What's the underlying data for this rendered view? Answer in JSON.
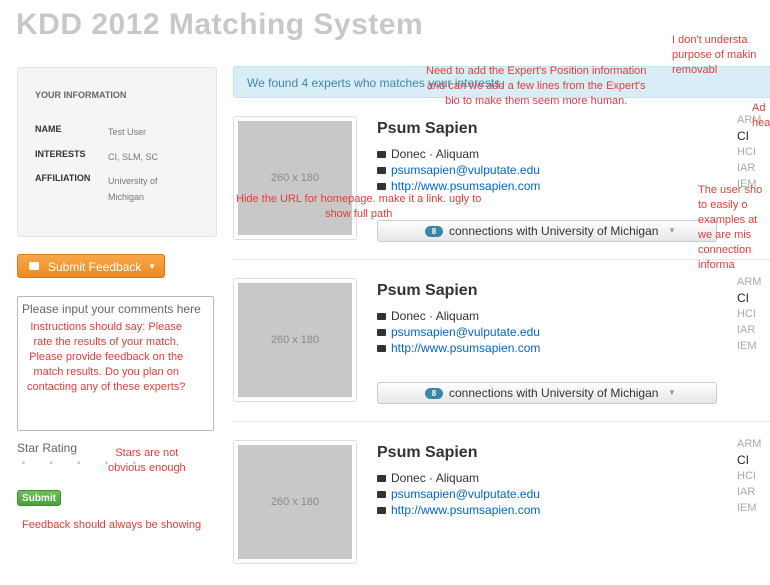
{
  "app": {
    "title": "KDD 2012 Matching System"
  },
  "sidebar": {
    "header": "YOUR INFORMATION",
    "rows": [
      {
        "key": "NAME",
        "value": "Test User"
      },
      {
        "key": "INTERESTS",
        "value": "CI, SLM, SC"
      },
      {
        "key": "AFFILIATION",
        "value": "University of Michigan"
      }
    ],
    "feedback_button": "Submit Feedback",
    "comments_placeholder": "Please input your comments here",
    "star_rating_label": "Star Rating",
    "stars": "• • • • •",
    "submit_button": "Submit"
  },
  "main": {
    "alert_text": "We found 4 experts who matches your interests.",
    "experts": [
      {
        "thumb": "260 x 180",
        "name": "Psum Sapien",
        "position": "Donec · Aliquam",
        "email": "psumsapien@vulputate.edu",
        "homepage": "http://www.psumsapien.com",
        "connections_count": "8",
        "connections_label": "connections with University of Michigan",
        "tags": [
          "ARM",
          "CI",
          "HCI",
          "IAR",
          "IEM"
        ],
        "active_tag": "CI"
      },
      {
        "thumb": "260 x 180",
        "name": "Psum Sapien",
        "position": "Donec · Aliquam",
        "email": "psumsapien@vulputate.edu",
        "homepage": "http://www.psumsapien.com",
        "connections_count": "8",
        "connections_label": "connections with University of Michigan",
        "tags": [
          "ARM",
          "CI",
          "HCI",
          "IAR",
          "IEM"
        ],
        "active_tag": "CI"
      },
      {
        "thumb": "260 x 180",
        "name": "Psum Sapien",
        "position": "Donec · Aliquam",
        "email": "psumsapien@vulputate.edu",
        "homepage": "http://www.psumsapien.com",
        "tags": [
          "ARM",
          "CI",
          "HCI",
          "IAR",
          "IEM"
        ],
        "active_tag": "CI"
      }
    ]
  },
  "annotations": {
    "position_info": "Need to add the Expert's Position information\nand can we add a few lines from the Expert's\nbio to make them seem more human.",
    "removable": "I don't understa\npurpose of makin\nremovabl",
    "header_note": "Ad\nheade",
    "homepage_link": "Hide the URL for homepage. make it a link. ugly to\nshow full path",
    "connections_note": "The user sho\nto easily o\nexamples at\nwe are mis\nconnection\ninforma",
    "instructions": "Instructions should say: Please\nrate the results of your match.\nPlease provide feedback on the\nmatch results. Do you plan on\ncontacting any of these experts?",
    "stars_note": "Stars are not\nobvious enough",
    "feedback_note": "Feedback should always be showing"
  }
}
